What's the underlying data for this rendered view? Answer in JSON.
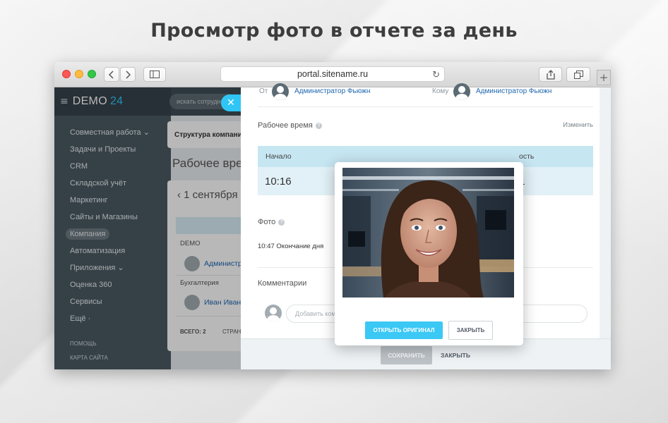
{
  "headline": "Просмотр фото в отчете за день",
  "browser": {
    "url": "portal.sitename.ru"
  },
  "sidebar": {
    "logo_main": "DEMO",
    "logo_num": "24",
    "items": [
      {
        "label": "Совместная работа ⌄"
      },
      {
        "label": "Задачи и Проекты"
      },
      {
        "label": "CRM"
      },
      {
        "label": "Складской учёт"
      },
      {
        "label": "Маркетинг"
      },
      {
        "label": "Сайты и Магазины"
      },
      {
        "label": "Компания"
      },
      {
        "label": "Автоматизация"
      },
      {
        "label": "Приложения ⌄"
      },
      {
        "label": "Оценка 360"
      },
      {
        "label": "Сервисы"
      },
      {
        "label": "Ещё ·"
      }
    ],
    "help": "ПОМОЩЬ",
    "sitemap": "КАРТА САЙТА"
  },
  "topbar": {
    "search_placeholder": "искать сотрудника"
  },
  "background": {
    "crumb": "Структура компании",
    "title": "Рабочее время",
    "date": "‹ 1 сентября",
    "group1": "DEMO",
    "user1": "Администратор",
    "group2": "Бухгалтерия",
    "user2": "Иван Иванов",
    "total": "ВСЕГО: 2",
    "pages": "СТРАНИЦЫ"
  },
  "report": {
    "from_label": "От",
    "from_user": "Администратор Фьюжн",
    "to_label": "Кому",
    "to_user": "Администратор Фьюжн",
    "worktime_label": "Рабочее время",
    "change_link": "Изменить",
    "start_header": "Начало",
    "start_value": "10:16",
    "col3_header": "ость",
    "col3_value": "1",
    "photo_label": "Фото",
    "photo_entry": "10:47 Окончание дня",
    "comments_label": "Комментарии",
    "comment_placeholder": "Добавить комментарий"
  },
  "footer": {
    "save": "СОХРАНИТЬ",
    "close": "ЗАКРЫТЬ"
  },
  "popup": {
    "open_original": "ОТКРЫТЬ ОРИГИНАЛ",
    "close": "ЗАКРЫТЬ"
  },
  "colors": {
    "accent": "#3bc8f5",
    "sidebar": "#4b5a63",
    "link": "#2067b0"
  }
}
